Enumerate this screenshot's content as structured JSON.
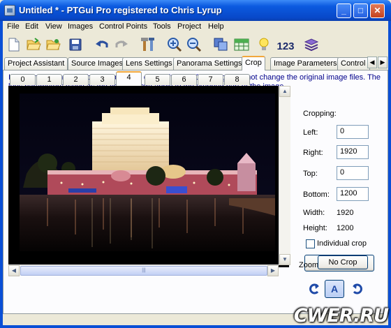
{
  "window": {
    "title": "Untitled * - PTGui Pro registered to Chris Lyrup",
    "minimize_glyph": "_",
    "maximize_glyph": "□",
    "close_glyph": "✕"
  },
  "menu": [
    "File",
    "Edit",
    "View",
    "Images",
    "Control Points",
    "Tools",
    "Project",
    "Help"
  ],
  "toolbar": {
    "icons": [
      "new-icon",
      "open-icon",
      "open-recent-icon",
      "save-icon",
      "undo-icon",
      "redo-icon",
      "tools-icon",
      "zoom-in-icon",
      "zoom-out-icon",
      "panorama-editor-icon",
      "table-icon",
      "tip-icon",
      "numbering-icon",
      "batch-icon"
    ],
    "number_label": "123"
  },
  "tabs": {
    "items": [
      "Project Assistant",
      "Source Images",
      "Lens Settings",
      "Panorama Settings",
      "Crop",
      "Image Parameters",
      "Control"
    ],
    "active": "Crop",
    "scroll_left": "◀",
    "scroll_right": "▶"
  },
  "crop": {
    "info": "If your images need to be cropped, you can do it here. Cropping does not change the original image files. The lens parameters (such as the field of view) apply to the cropped part of the image.",
    "image_tabs": [
      "0",
      "1",
      "2",
      "3",
      "4",
      "5",
      "6",
      "7",
      "8"
    ],
    "active_image": "4",
    "cropping_label": "Cropping:",
    "left_label": "Left:",
    "left_value": "0",
    "right_label": "Right:",
    "right_value": "1920",
    "top_label": "Top:",
    "top_value": "0",
    "bottom_label": "Bottom:",
    "bottom_value": "1200",
    "width_label": "Width:",
    "width_value": "1920",
    "height_label": "Height:",
    "height_value": "1200",
    "individual_crop_label": "Individual crop",
    "individual_crop_checked": false,
    "no_crop_button": "No Crop",
    "zoom_label": "Zoom:",
    "auto_button": "A"
  },
  "watermark": "CWER.RU",
  "colors": {
    "titlebar": "#0b5ae0",
    "info_text": "#00008b",
    "active_tab_accent": "#f1a73b",
    "window_bg": "#ece9d8"
  }
}
